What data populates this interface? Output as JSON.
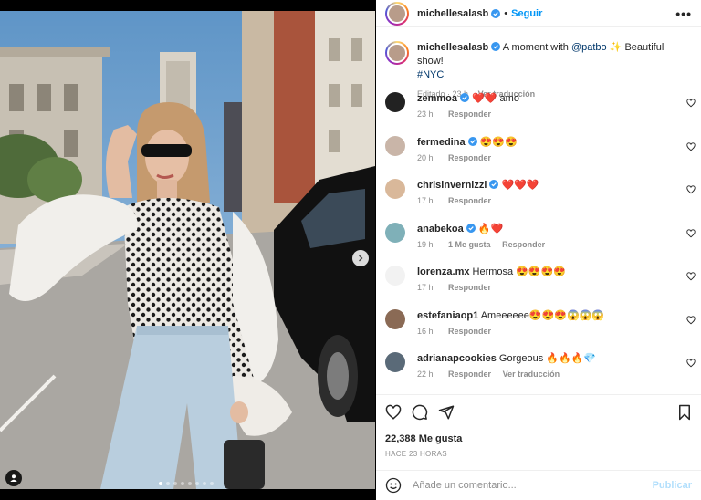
{
  "header": {
    "username": "michellesalasb",
    "separator": "•",
    "follow_label": "Seguir",
    "more_label": "•••"
  },
  "caption": {
    "username": "michellesalasb",
    "text_before": "A moment with",
    "mention": "@patbo",
    "text_after": "✨ Beautiful show!",
    "hashtag": "#NYC",
    "edited": "Editado",
    "time": "23 h",
    "translate": "Ver traducción"
  },
  "comments": [
    {
      "user": "zemmoa",
      "text": "❤️❤️ amo",
      "time": "23 h",
      "reply": "Responder",
      "likes": "",
      "translate": "",
      "verified": true,
      "avatar": "#222222"
    },
    {
      "user": "fermedina",
      "text": "😍😍😍",
      "time": "20 h",
      "reply": "Responder",
      "likes": "",
      "translate": "",
      "verified": true,
      "avatar": "#c9b5a8"
    },
    {
      "user": "chrisinvernizzi",
      "text": "❤️❤️❤️",
      "time": "17 h",
      "reply": "Responder",
      "likes": "",
      "translate": "",
      "verified": true,
      "avatar": "#d9b89a"
    },
    {
      "user": "anabekoa",
      "text": "🔥❤️",
      "time": "19 h",
      "reply": "Responder",
      "likes": "1 Me gusta",
      "translate": "",
      "verified": true,
      "avatar": "#7fb0b8"
    },
    {
      "user": "lorenza.mx",
      "text": "Hermosa 😍😍😍😍",
      "time": "17 h",
      "reply": "Responder",
      "likes": "",
      "translate": "",
      "verified": false,
      "avatar": "#f2f2f2"
    },
    {
      "user": "estefaniaop1",
      "text": "Ameeeeee😍😍😍😱😱😱",
      "time": "16 h",
      "reply": "Responder",
      "likes": "",
      "translate": "",
      "verified": false,
      "avatar": "#8a6a55"
    },
    {
      "user": "adrianapcookies",
      "text": "Gorgeous 🔥🔥🔥💎",
      "time": "22 h",
      "reply": "Responder",
      "likes": "",
      "translate": "Ver traducción",
      "verified": false,
      "avatar": "#5a6a78"
    }
  ],
  "actions": {
    "likes": "22,388 Me gusta",
    "ago": "HACE 23 HORAS"
  },
  "add_comment": {
    "placeholder": "Añade un comentario...",
    "publish_label": "Publicar"
  },
  "carousel": {
    "slides": 8,
    "active_index": 0
  },
  "colors": {
    "accent": "#0095f6",
    "verified": "#3897f0",
    "muted": "#8e8e8e"
  },
  "icons": [
    "user-tag-icon",
    "chevron-right-icon",
    "heart-icon",
    "comment-icon",
    "share-icon",
    "bookmark-icon",
    "emoji-icon",
    "verified-icon",
    "more-icon"
  ]
}
